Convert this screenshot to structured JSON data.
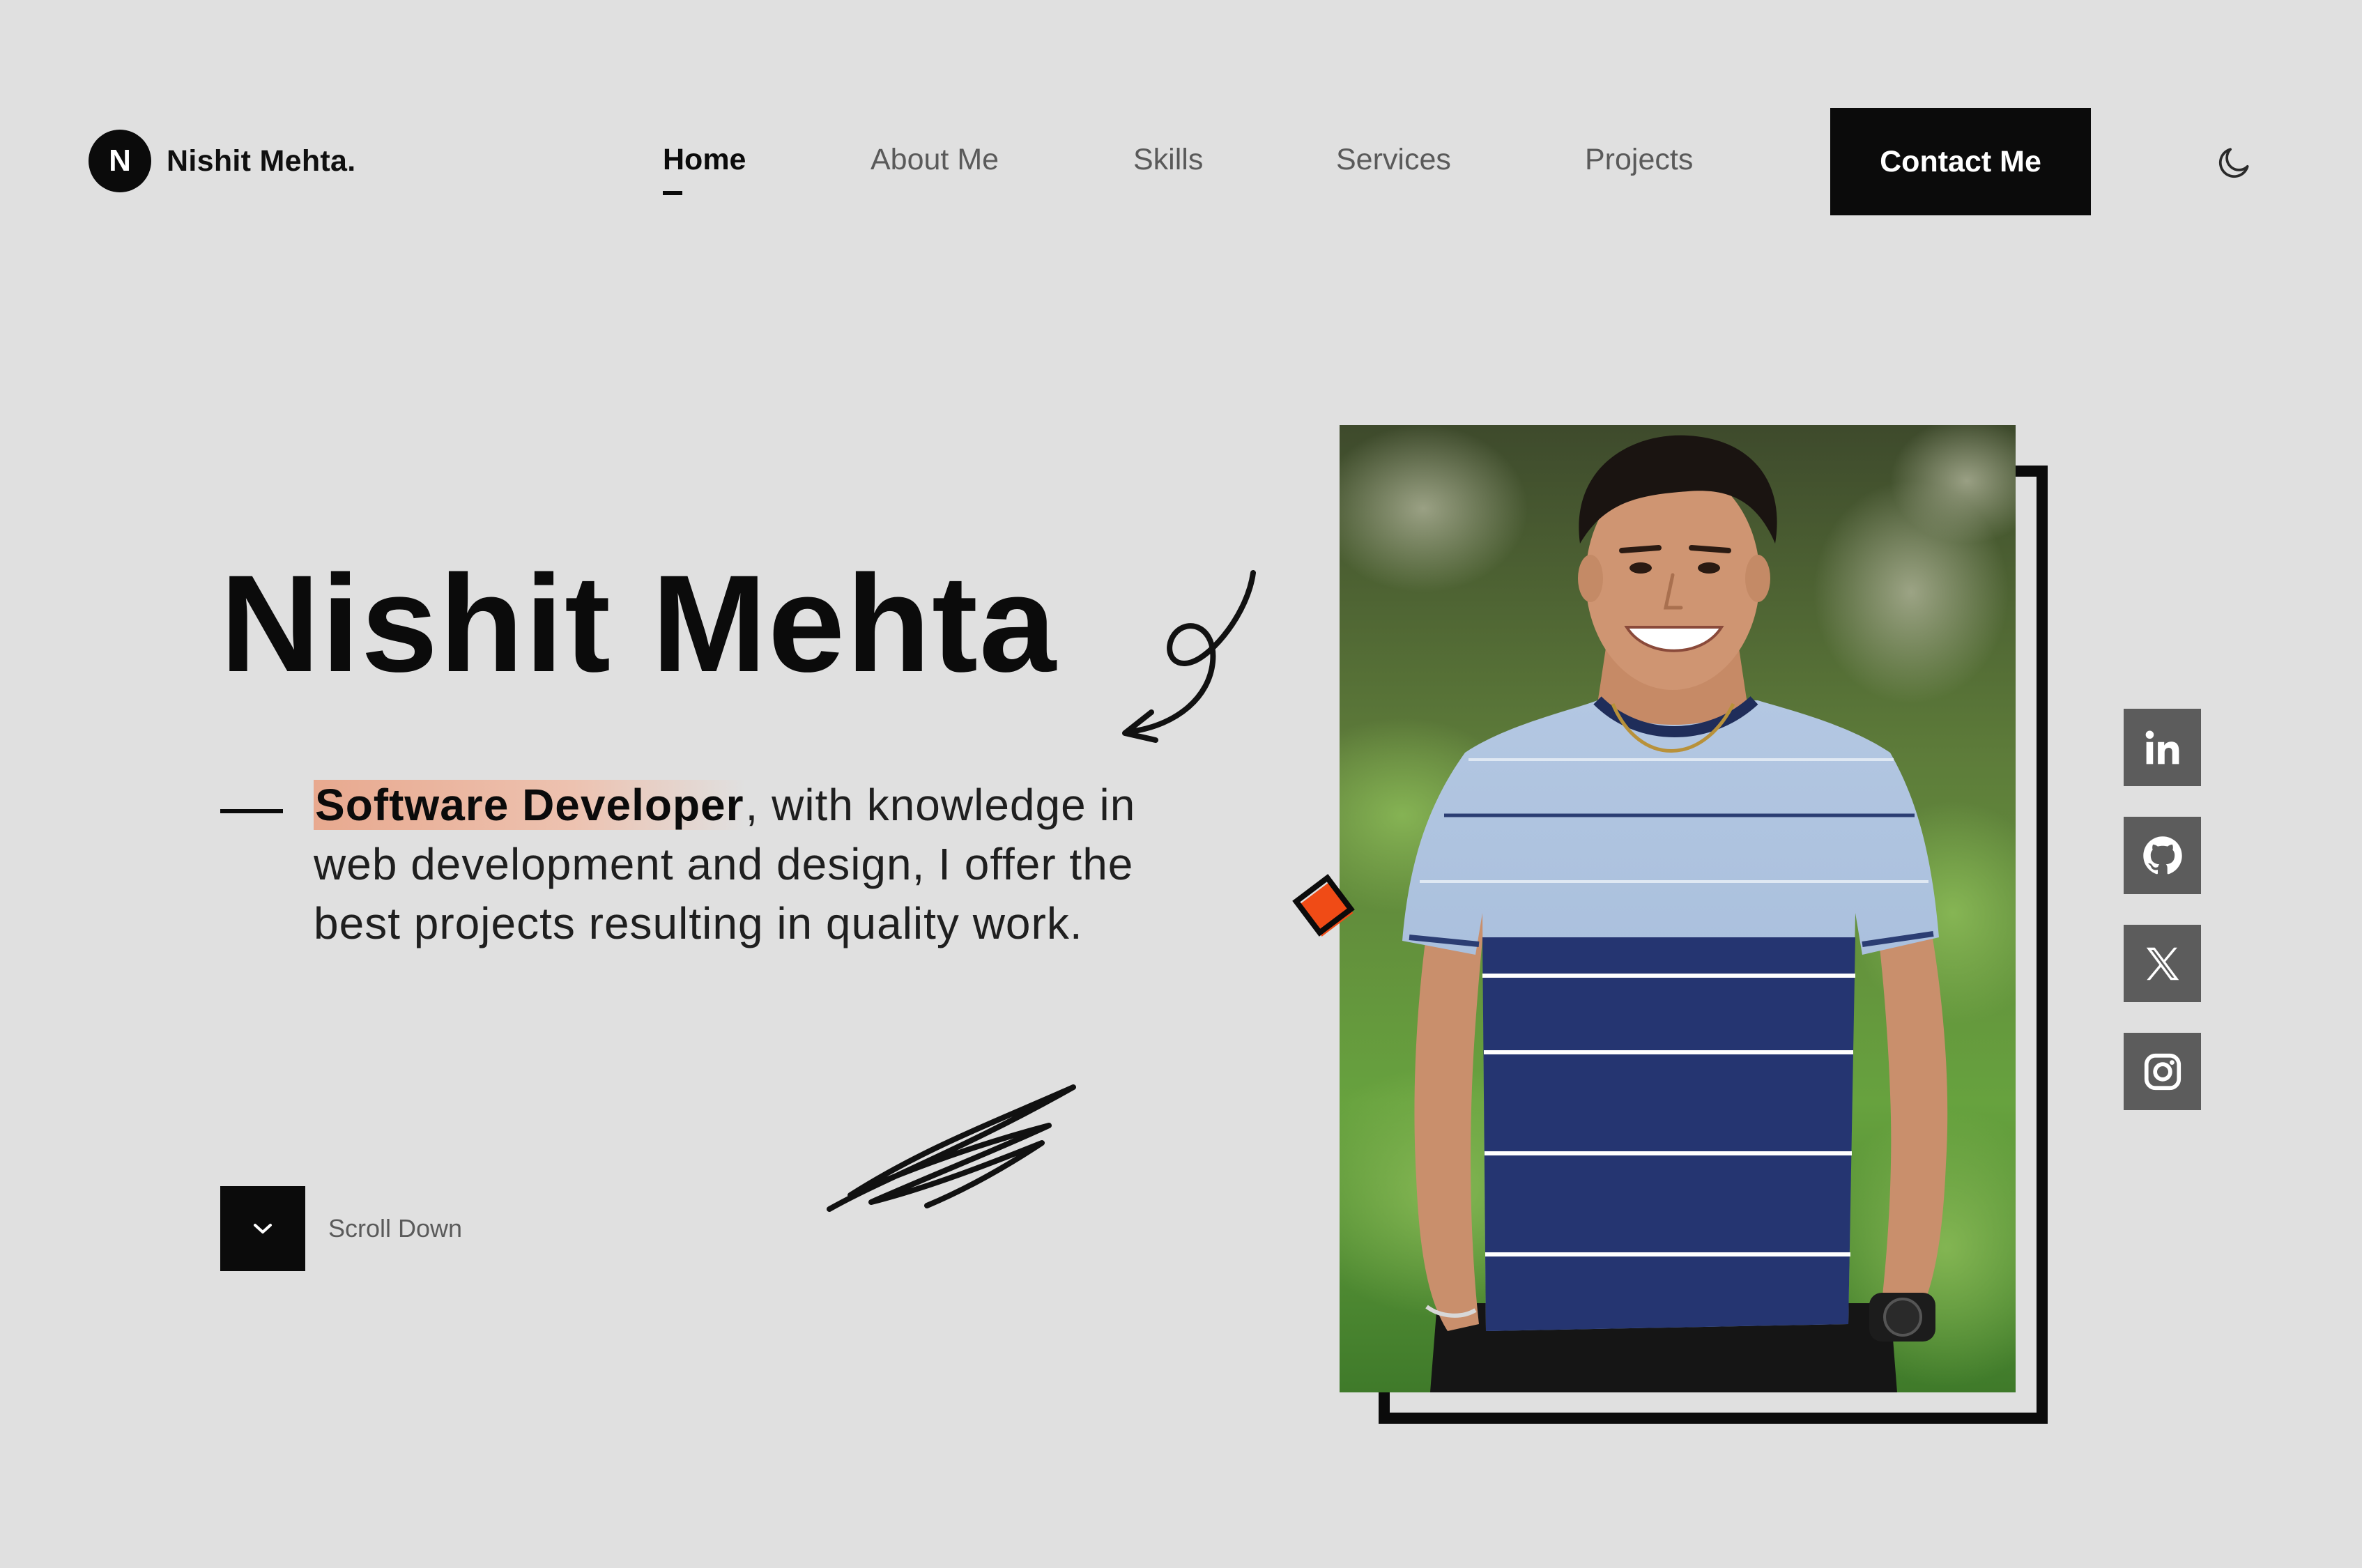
{
  "header": {
    "logo_letter": "N",
    "logo_text": "Nishit Mehta.",
    "nav": [
      {
        "label": "Home",
        "active": true
      },
      {
        "label": "About Me",
        "active": false
      },
      {
        "label": "Skills",
        "active": false
      },
      {
        "label": "Services",
        "active": false
      },
      {
        "label": "Projects",
        "active": false
      }
    ],
    "contact_label": "Contact Me",
    "theme_icon": "moon-icon"
  },
  "hero": {
    "name": "Nishit Mehta",
    "bio_highlight": "Software Developer",
    "bio_rest": ", with knowledge in web development and design, I offer the best projects resulting in quality work.",
    "scroll_icon": "chevron-down-icon",
    "scroll_label": "Scroll Down"
  },
  "social": [
    {
      "name": "linkedin-icon"
    },
    {
      "name": "github-icon"
    },
    {
      "name": "x-icon"
    },
    {
      "name": "instagram-icon"
    }
  ],
  "colors": {
    "background": "#e0e0e0",
    "primary": "#0b0b0b",
    "accent": "#f04b16",
    "highlight": "#e8a98f",
    "social_bg": "#5c5c5c"
  }
}
